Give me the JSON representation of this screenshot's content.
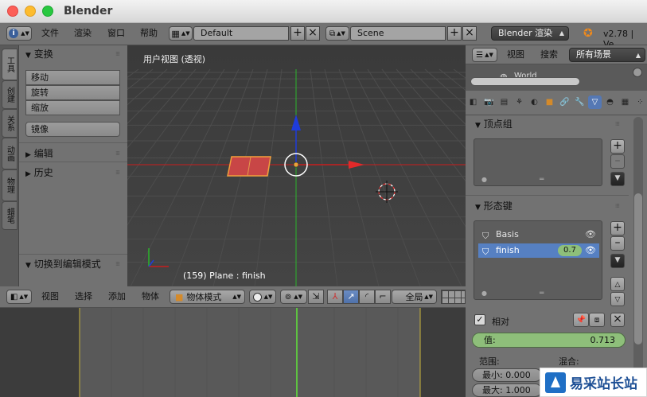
{
  "window": {
    "title": "Blender"
  },
  "top_header": {
    "menus": [
      "文件",
      "渲染",
      "窗口",
      "帮助"
    ],
    "screen_layout": "Default",
    "scene": "Scene",
    "render_engine": "Blender 渲染",
    "version": "v2.78 | Ve"
  },
  "tool_tabs": [
    "工具",
    "创建",
    "关系",
    "动画",
    "物理",
    "蜡笔"
  ],
  "tool_shelf": {
    "transform_title": "变换",
    "transform_buttons": [
      "移动",
      "旋转",
      "缩放"
    ],
    "mirror_button": "镜像",
    "edit_title": "编辑",
    "history_title": "历史",
    "operator_title": "切换到编辑模式"
  },
  "viewport": {
    "label": "用户视图 (透视)",
    "status": "(159) Plane : finish"
  },
  "view3d_header": {
    "menus": [
      "视图",
      "选择",
      "添加",
      "物体"
    ],
    "mode": "物体模式",
    "orientation": "全局"
  },
  "outliner": {
    "menus": [
      "视图",
      "搜索"
    ],
    "filter": "所有场景",
    "partial_item": "World"
  },
  "properties": {
    "vertex_groups_title": "顶点组",
    "shape_keys_title": "形态键",
    "shape_keys": [
      {
        "name": "Basis",
        "value": ""
      },
      {
        "name": "finish",
        "value": "0.7"
      }
    ],
    "relative_label": "相对",
    "value_label": "值:",
    "value": "0.713",
    "value_fraction": 0.713,
    "range_label": "范围:",
    "blend_label": "混合:",
    "min_label": "最小: 0.000",
    "max_label": "最大: 1.000"
  },
  "watermark": {
    "text": "易采站长站"
  },
  "colors": {
    "accent_blue": "#5680c2",
    "value_green": "#8ebf7a",
    "x_axis": "#c81e1e",
    "y_axis": "#2bb52b",
    "z_arrow": "#1e3cdc",
    "plane_fill": "#c84646",
    "plane_outline": "#f3a03c"
  }
}
